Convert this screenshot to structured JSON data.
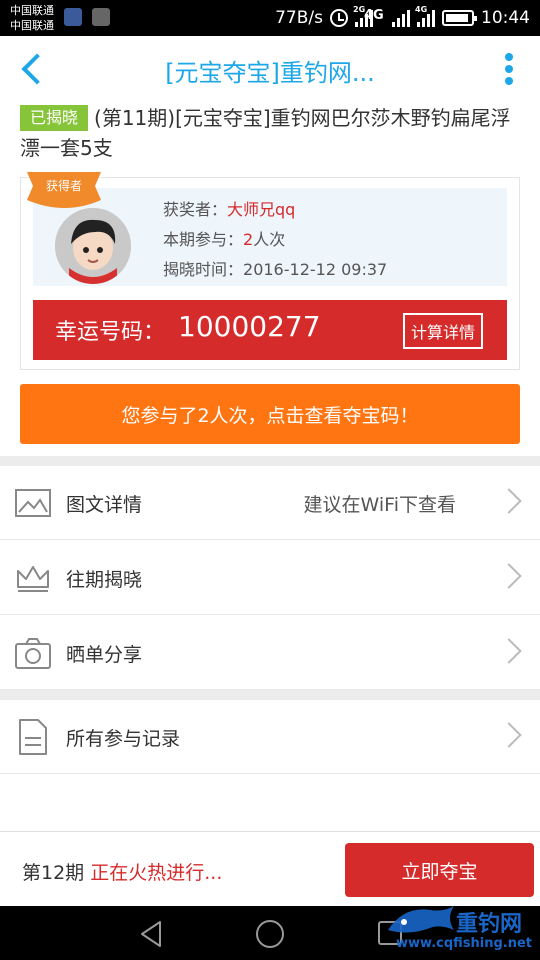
{
  "status_bar": {
    "carrier_1": "中国联通",
    "carrier_2": "中国联通",
    "net_speed": "77B/s",
    "net_type_1": "2G",
    "net_type_2": "4G",
    "net_type_3": "4G",
    "time": "10:44",
    "battery_level": 0.9
  },
  "header": {
    "title": "[元宝夺宝]重钓网...",
    "back_icon": "chevron-left-icon",
    "more_icon": "vertical-dots-icon",
    "accent_color": "#1ea7e8"
  },
  "product": {
    "badge": "已揭晓",
    "title": "(第11期)[元宝夺宝]重钓网巴尔莎木野钓扁尾浮漂一套5支"
  },
  "winner": {
    "ribbon": "获得者",
    "winner_label": "获奖者：",
    "winner_name": "大师兄qq",
    "participation_label": "本期参与：",
    "participation_count": "2",
    "participation_unit": "人次",
    "reveal_label": "揭晓时间：",
    "reveal_time": "2016-12-12 09:37"
  },
  "lucky": {
    "label": "幸运号码：",
    "number": "10000277",
    "calc_button": "计算详情"
  },
  "my_codes_button": "您参与了2人次，点击查看夺宝码！",
  "menu": [
    {
      "label": "图文详情",
      "hint": "建议在WiFi下查看",
      "icon": "image-icon"
    },
    {
      "label": "往期揭晓",
      "hint": "",
      "icon": "crown-icon"
    },
    {
      "label": "晒单分享",
      "hint": "",
      "icon": "camera-icon"
    },
    {
      "label": "所有参与记录",
      "hint": "",
      "icon": "document-icon"
    }
  ],
  "bottom_bar": {
    "issue": "第12期",
    "status": "正在火热进行...",
    "buy_button": "立即夺宝"
  },
  "watermark": {
    "brand": "重钓网",
    "url": "www.cqfishing.net"
  },
  "colors": {
    "red": "#d62b2b",
    "orange": "#ff7511",
    "green_badge": "#86c43a",
    "blue": "#1ea7e8"
  }
}
